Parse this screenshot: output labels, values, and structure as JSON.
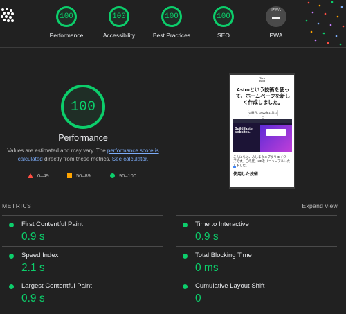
{
  "categories": [
    {
      "score": "100",
      "label": "Performance"
    },
    {
      "score": "100",
      "label": "Accessibility"
    },
    {
      "score": "100",
      "label": "Best Practices"
    },
    {
      "score": "100",
      "label": "SEO"
    }
  ],
  "pwa": {
    "badge": "PWA",
    "label": "PWA"
  },
  "performance": {
    "score": "100",
    "title": "Performance",
    "note_prefix": "Values are estimated and may vary. The ",
    "note_link": "performance score is calculated",
    "note_mid": " directly from these metrics. ",
    "note_calc": "See calculator."
  },
  "legend": {
    "fail": "0–49",
    "average": "50–89",
    "pass": "90–100"
  },
  "screenshot": {
    "logo": "Toru Blog",
    "title": "Astroという技術を使って、ホームページを新しく作成しました。",
    "date": "公開日：2022年11月13日",
    "hero_text": "Build faster websites.",
    "paragraph": "こんにちは、みしまウェブクリエイターズです。この度、HPをリニューアルいたしました。",
    "subheading": "使用した技術"
  },
  "metrics_section": {
    "title": "METRICS",
    "expand": "Expand view"
  },
  "metrics": [
    {
      "label": "First Contentful Paint",
      "value": "0.9 s"
    },
    {
      "label": "Time to Interactive",
      "value": "0.9 s"
    },
    {
      "label": "Speed Index",
      "value": "2.1 s"
    },
    {
      "label": "Total Blocking Time",
      "value": "0 ms"
    },
    {
      "label": "Largest Contentful Paint",
      "value": "0.9 s"
    },
    {
      "label": "Cumulative Layout Shift",
      "value": "0"
    }
  ],
  "colors": {
    "pass": "#0cce6b",
    "average": "#ffa400",
    "fail": "#ff4e42",
    "link": "#7cacf8"
  }
}
